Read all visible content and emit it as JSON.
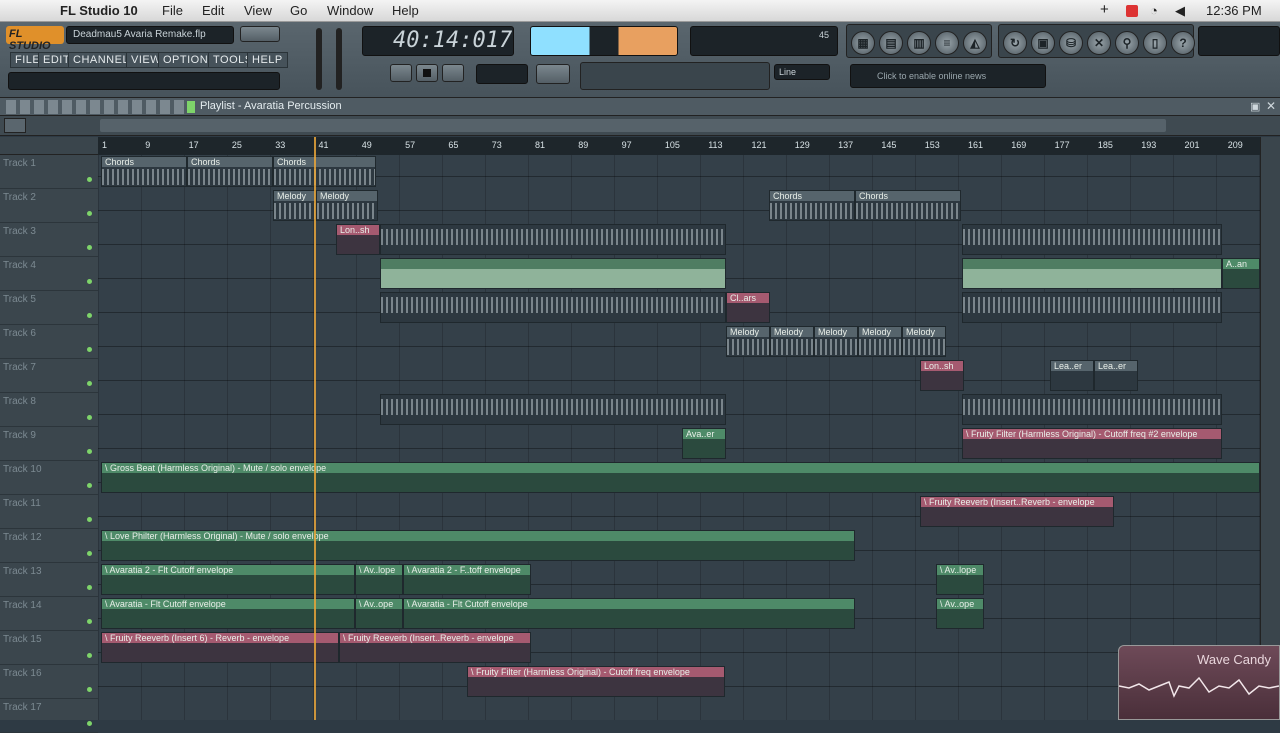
{
  "mac_menu": {
    "app": "FL Studio 10",
    "items": [
      "File",
      "Edit",
      "View",
      "Go",
      "Window",
      "Help"
    ],
    "time": "12:36 PM"
  },
  "toolbar": {
    "logo": "FL STUDIO",
    "project_file": "Deadmau5 Avaria Remake.flp",
    "menu": [
      "FILE",
      "EDIT",
      "CHANNELS",
      "VIEW",
      "OPTIONS",
      "TOOLS",
      "HELP"
    ],
    "time_display": "40:14:017",
    "tempo_label": "Line",
    "news_text": "Click to enable online news",
    "cpu_value": "45"
  },
  "playlist": {
    "title": "Playlist - Avaratia Percussion",
    "ruler": [
      "1",
      "9",
      "17",
      "25",
      "33",
      "41",
      "49",
      "57",
      "65",
      "73",
      "81",
      "89",
      "97",
      "105",
      "113",
      "121",
      "129",
      "137",
      "145",
      "153",
      "161",
      "169",
      "177",
      "185",
      "193",
      "201",
      "209"
    ]
  },
  "tracks": [
    "Track 1",
    "Track 2",
    "Track 3",
    "Track 4",
    "Track 5",
    "Track 6",
    "Track 7",
    "Track 8",
    "Track 9",
    "Track 10",
    "Track 11",
    "Track 12",
    "Track 13",
    "Track 14",
    "Track 15",
    "Track 16",
    "Track 17"
  ],
  "clips": {
    "chords": "Chords",
    "melody": "Melody",
    "lon": "Lon..sh",
    "clap": "Cl..ars",
    "lea": "Lea..er",
    "ava": "Ava..er",
    "aend": "A..an",
    "gross": "\\ Gross Beat (Harmless Original) - Mute / solo envelope",
    "reverb11": "\\ Fruity Reeverb (Insert..Reverb - envelope",
    "love": "\\ Love Philter (Harmless Original) - Mute / solo envelope",
    "ava2": "\\ Avaratia 2 - Flt Cutoff envelope",
    "avope": "\\ Av..lope",
    "ava2b": "\\ Avaratia 2 - F..toff envelope",
    "ava1": "\\ Avaratia - Flt Cutoff envelope",
    "avope2": "\\ Av..ope",
    "reverb15": "\\ Fruity Reeverb (Insert 6) - Reverb - envelope",
    "reverb15b": "\\ Fruity Reeverb (Insert..Reverb - envelope",
    "filter9": "\\ Fruity Filter (Harmless Original) - Cutoff freq #2 envelope",
    "filter16": "\\ Fruity Filter (Harmless Original) - Cutoff freq envelope"
  },
  "wave_candy": "Wave Candy"
}
